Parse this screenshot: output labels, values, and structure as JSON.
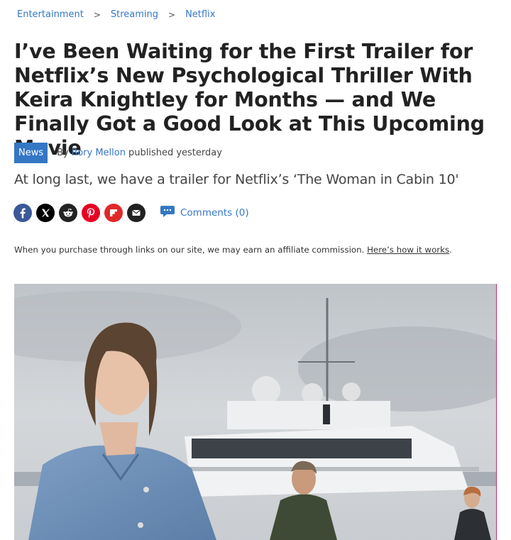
{
  "breadcrumb": {
    "items": [
      "Entertainment",
      "Streaming",
      "Netflix"
    ],
    "separator": ">"
  },
  "article": {
    "headline": "I’ve Been Waiting for the First Trailer for Netflix’s New Psychological Thriller With Keira Knightley for Months — and We Finally Got a Good Look at This Upcoming Movie",
    "tag": "News",
    "by": "By",
    "author": "Rory Mellon",
    "published": "published yesterday",
    "strapline": "At long last, we have a trailer for Netflix’s ‘The Woman in Cabin 10'"
  },
  "share": {
    "icons": [
      "facebook-icon",
      "x-icon",
      "reddit-icon",
      "pinterest-icon",
      "flipboard-icon",
      "email-icon"
    ],
    "comments_label": "Comments (0)"
  },
  "affiliate": {
    "text": "When you purchase through links on our site, we may earn an affiliate commission. ",
    "link": "Here’s how it works",
    "end": "."
  },
  "colors": {
    "link": "#3477c4",
    "facebook": "#3b5998",
    "x": "#000000",
    "reddit": "#222222",
    "pinterest": "#e60023",
    "flipboard": "#e12828",
    "email": "#222222"
  }
}
